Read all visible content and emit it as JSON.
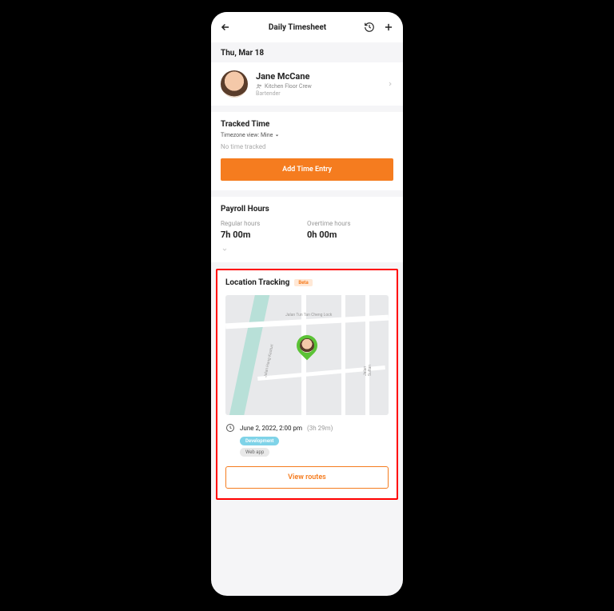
{
  "header": {
    "title": "Daily Timesheet"
  },
  "date": "Thu, Mar 18",
  "person": {
    "name": "Jane McCane",
    "group": "Kitchen Floor Crew",
    "role": "Bartender"
  },
  "tracked": {
    "title": "Tracked Time",
    "tz_label": "Timezone view: Mine",
    "empty": "No time tracked",
    "add_btn": "Add Time Entry"
  },
  "payroll": {
    "title": "Payroll Hours",
    "regular_label": "Regular hours",
    "regular_value": "7h 00m",
    "overtime_label": "Overtime hours",
    "overtime_value": "0h 00m"
  },
  "location": {
    "title": "Location Tracking",
    "badge": "Beta",
    "street1": "Jalan Tun Tan Cheng Lock",
    "street2": "Jalan Hang Kasturi",
    "street3": "Jalan Sultan",
    "timestamp": "June 2, 2022, 2:00 pm",
    "duration": "(3h 29m)",
    "tag1": "Development",
    "tag2": "Web app",
    "routes_btn": "View routes"
  }
}
